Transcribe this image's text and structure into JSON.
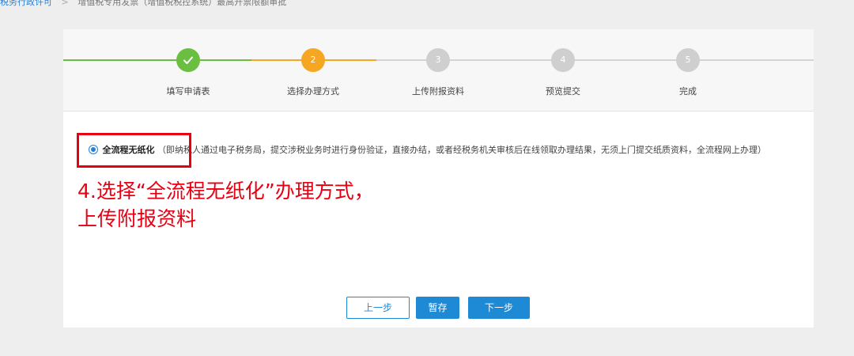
{
  "breadcrumb": {
    "link": "税务行政许可",
    "separator": ">",
    "current": "增值税专用发票（增值税税控系统）最高开票限额审批"
  },
  "steps": [
    {
      "number": "1",
      "label": "填写申请表",
      "status": "done"
    },
    {
      "number": "2",
      "label": "选择办理方式",
      "status": "active"
    },
    {
      "number": "3",
      "label": "上传附报资料",
      "status": "todo"
    },
    {
      "number": "4",
      "label": "预览提交",
      "status": "todo"
    },
    {
      "number": "5",
      "label": "完成",
      "status": "todo"
    }
  ],
  "option": {
    "title": "全流程无纸化",
    "description": "（即纳税人通过电子税务局，提交涉税业务时进行身份验证，直接办结，或者经税务机关审核后在线领取办理结果，无须上门提交纸质资料，全流程网上办理）",
    "selected": true
  },
  "annotation": {
    "line1": "4.选择“全流程无纸化”办理方式，",
    "line2": "上传附报资料"
  },
  "buttons": {
    "prev": "上一步",
    "save": "暂存",
    "next": "下一步"
  },
  "colors": {
    "done": "#6abf40",
    "active": "#f5a623",
    "todo": "#cfcfcf",
    "primary": "#1e8ad6",
    "annotation": "#e60012"
  }
}
